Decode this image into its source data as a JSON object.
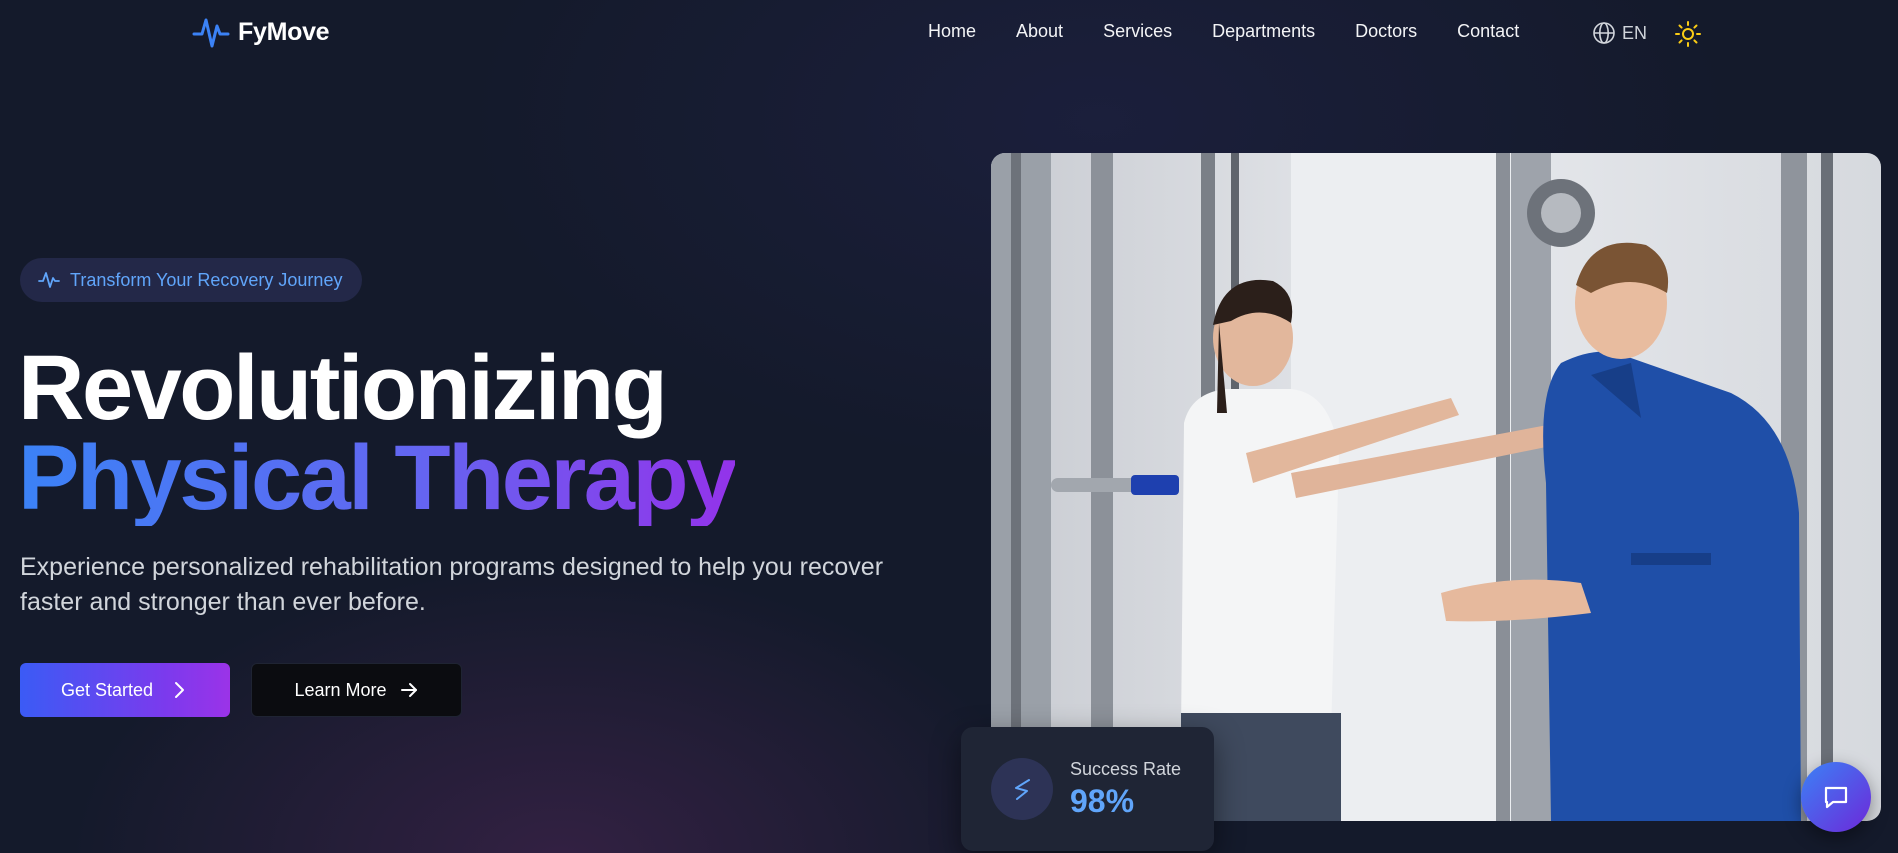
{
  "brand": {
    "name": "FyMove",
    "logo_icon": "pulse-icon",
    "accent": "#3b82f6"
  },
  "nav": {
    "items": [
      {
        "label": "Home"
      },
      {
        "label": "About"
      },
      {
        "label": "Services"
      },
      {
        "label": "Departments"
      },
      {
        "label": "Doctors"
      },
      {
        "label": "Contact"
      }
    ],
    "language": {
      "label": "EN",
      "icon": "globe-icon"
    },
    "theme_toggle": {
      "icon": "sun-icon",
      "color": "#facc15"
    }
  },
  "hero": {
    "badge": {
      "text": "Transform Your Recovery Journey",
      "icon": "pulse-icon",
      "color": "#60a5fa"
    },
    "title_line1": "Revolutionizing",
    "title_line2": "Physical Therapy",
    "subtitle": "Experience personalized rehabilitation programs designed to help you recover faster and stronger than ever before.",
    "primary_button": {
      "label": "Get Started",
      "icon": "chevron-right-icon"
    },
    "secondary_button": {
      "label": "Learn More",
      "icon": "arrow-right-icon"
    },
    "image": {
      "subject": "therapist-with-patient-photo"
    }
  },
  "stat_card": {
    "label": "Success Rate",
    "value": "98%",
    "icon": "pulse-icon"
  },
  "chat": {
    "icon": "chat-bubble-icon"
  },
  "colors": {
    "background": "#141a2b",
    "gradient_start": "#3b82f6",
    "gradient_end": "#9333ea",
    "text_muted": "#d1d5db"
  }
}
